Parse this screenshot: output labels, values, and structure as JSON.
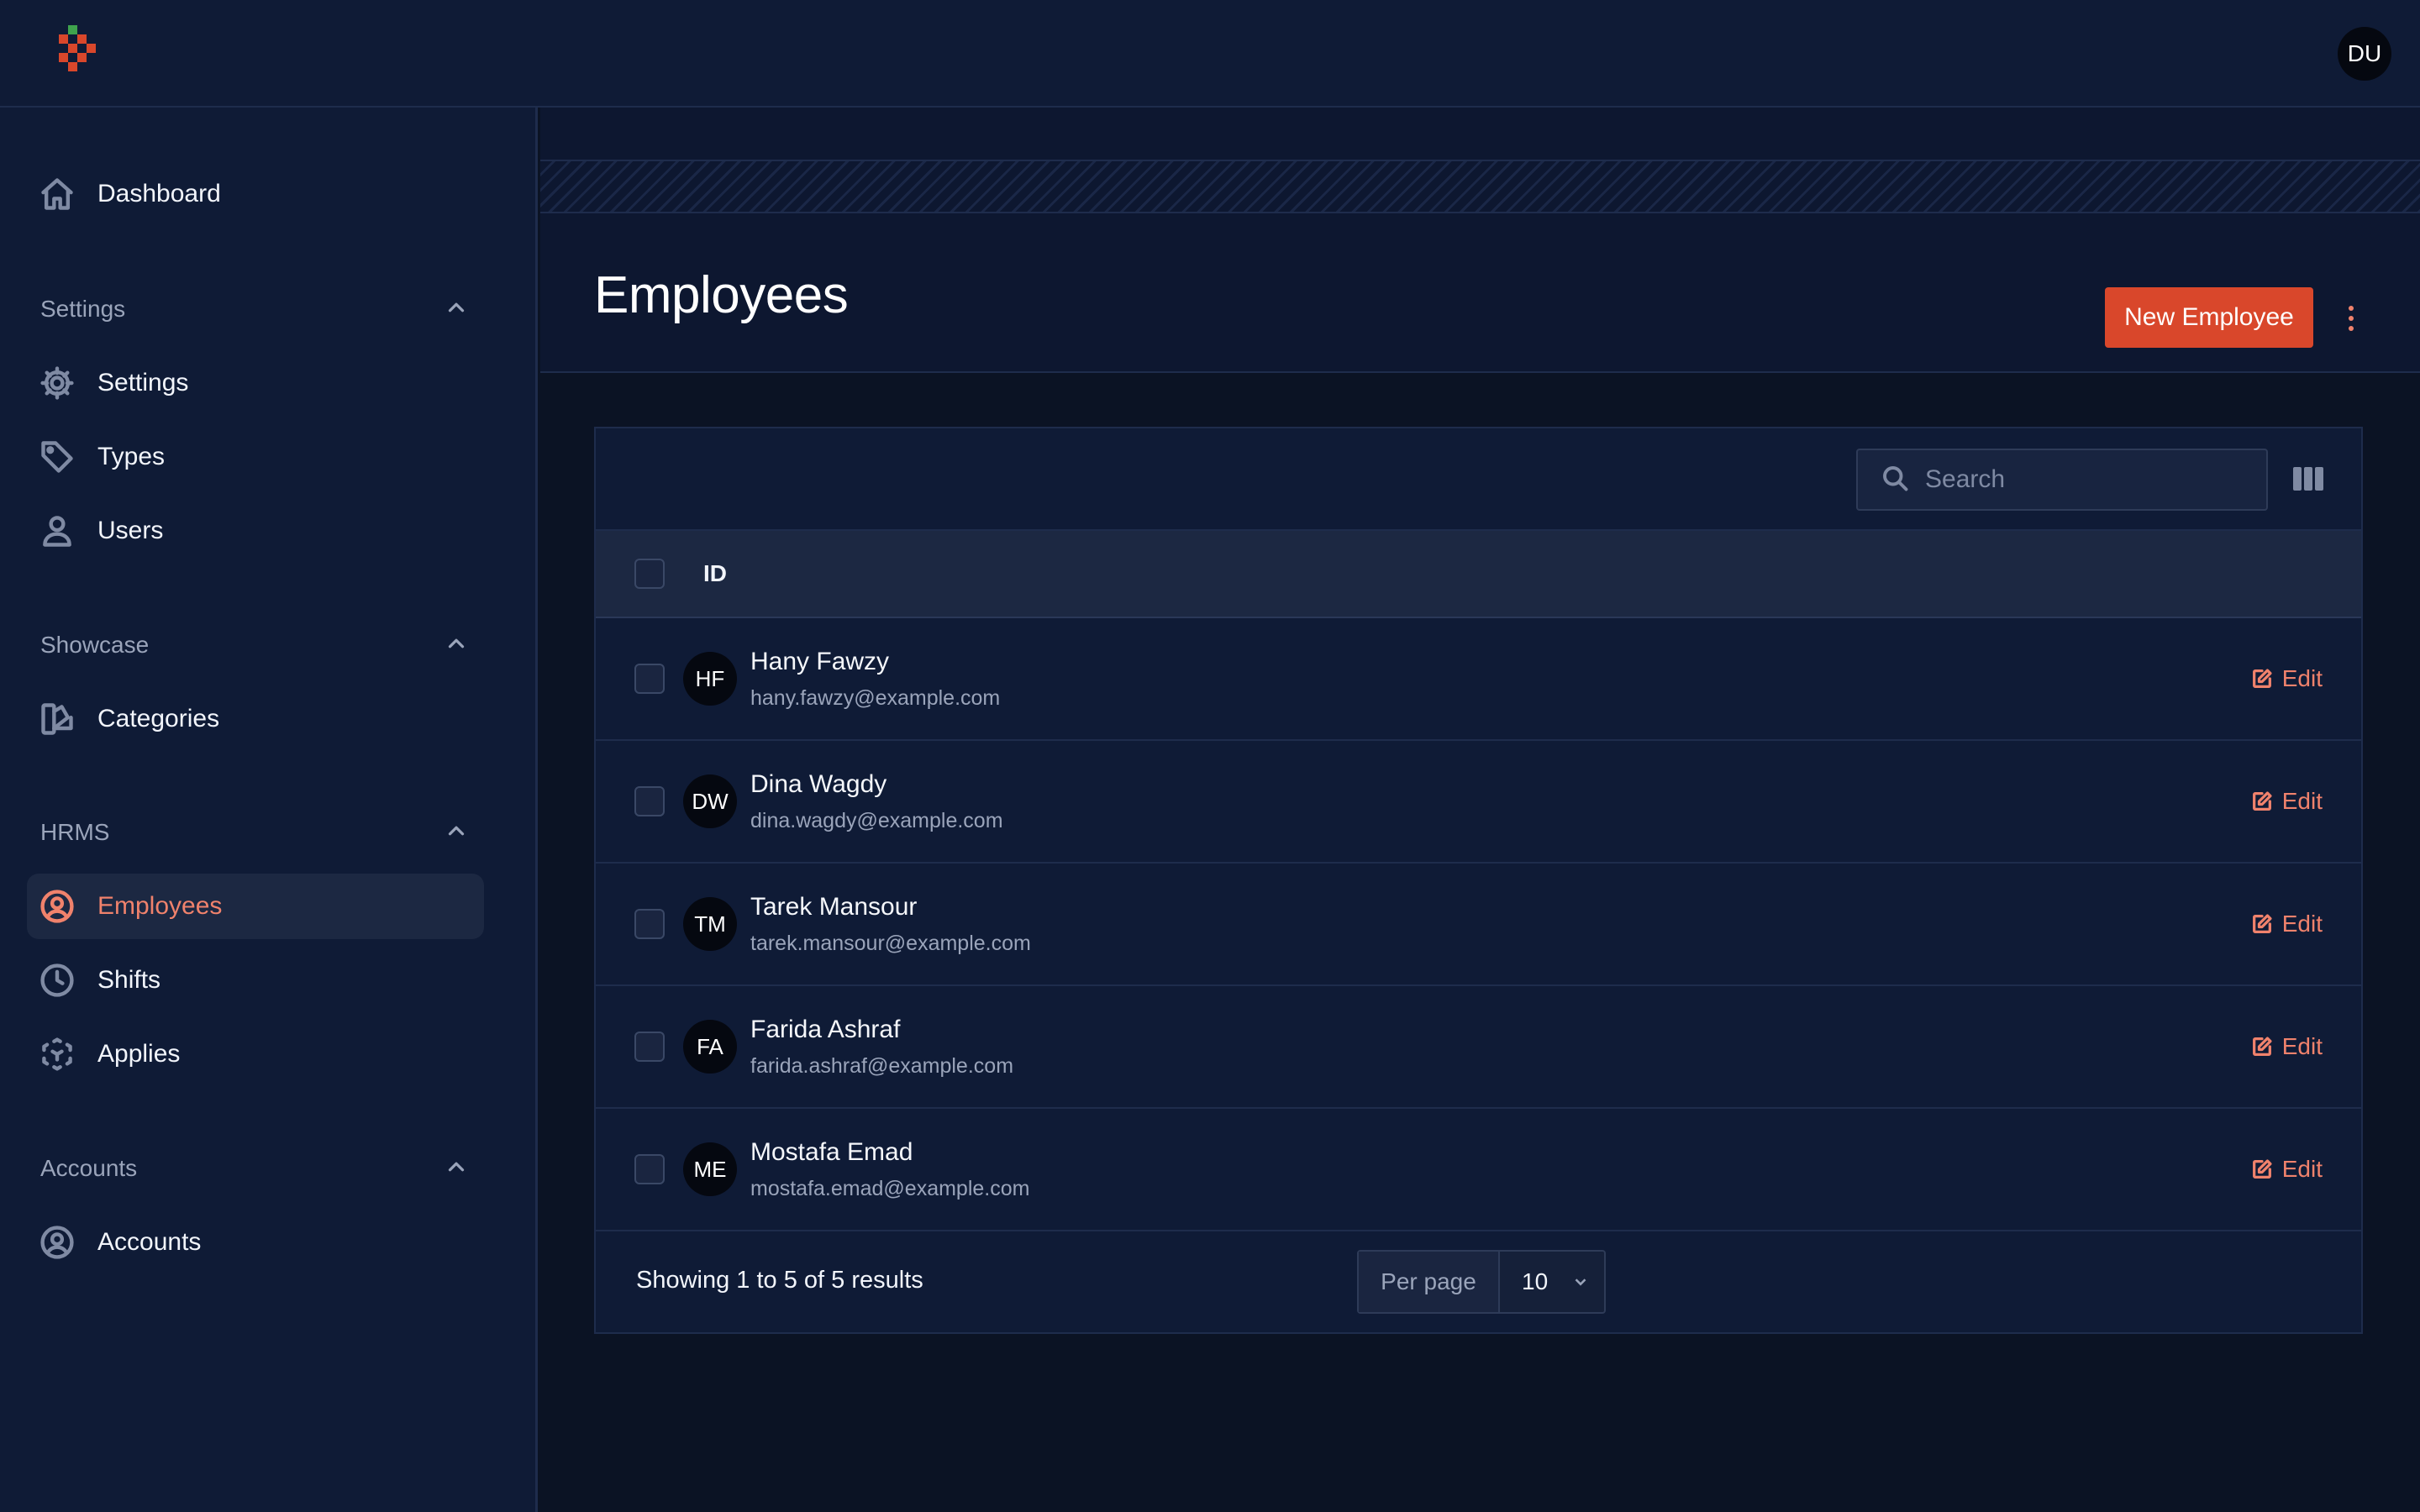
{
  "topbar": {
    "user_initials": "DU"
  },
  "sidebar": {
    "dashboard": {
      "label": "Dashboard",
      "icon": "home-icon"
    },
    "groups": [
      {
        "label": "Settings",
        "items": [
          {
            "label": "Settings",
            "icon": "gear-icon"
          },
          {
            "label": "Types",
            "icon": "tag-icon"
          },
          {
            "label": "Users",
            "icon": "user-icon"
          }
        ]
      },
      {
        "label": "Showcase",
        "items": [
          {
            "label": "Categories",
            "icon": "swatch-icon"
          }
        ]
      },
      {
        "label": "HRMS",
        "items": [
          {
            "label": "Employees",
            "icon": "user-circle-icon",
            "active": true
          },
          {
            "label": "Shifts",
            "icon": "clock-icon"
          },
          {
            "label": "Applies",
            "icon": "cube-icon"
          }
        ]
      },
      {
        "label": "Accounts",
        "items": [
          {
            "label": "Accounts",
            "icon": "user-circle-icon"
          }
        ]
      }
    ]
  },
  "page": {
    "title": "Employees",
    "new_button": "New Employee"
  },
  "table": {
    "search_placeholder": "Search",
    "column_id": "ID",
    "edit_label": "Edit",
    "rows": [
      {
        "initials": "HF",
        "name": "Hany Fawzy",
        "email": "hany.fawzy@example.com"
      },
      {
        "initials": "DW",
        "name": "Dina Wagdy",
        "email": "dina.wagdy@example.com"
      },
      {
        "initials": "TM",
        "name": "Tarek Mansour",
        "email": "tarek.mansour@example.com"
      },
      {
        "initials": "FA",
        "name": "Farida Ashraf",
        "email": "farida.ashraf@example.com"
      },
      {
        "initials": "ME",
        "name": "Mostafa Emad",
        "email": "mostafa.emad@example.com"
      }
    ],
    "showing": "Showing 1 to 5 of 5 results",
    "per_page_label": "Per page",
    "per_page_value": "10"
  },
  "colors": {
    "accent": "#d9472b",
    "accent_text": "#f0826c",
    "sidebar_bg": "#0f1b36",
    "main_bg": "#0b1324"
  }
}
